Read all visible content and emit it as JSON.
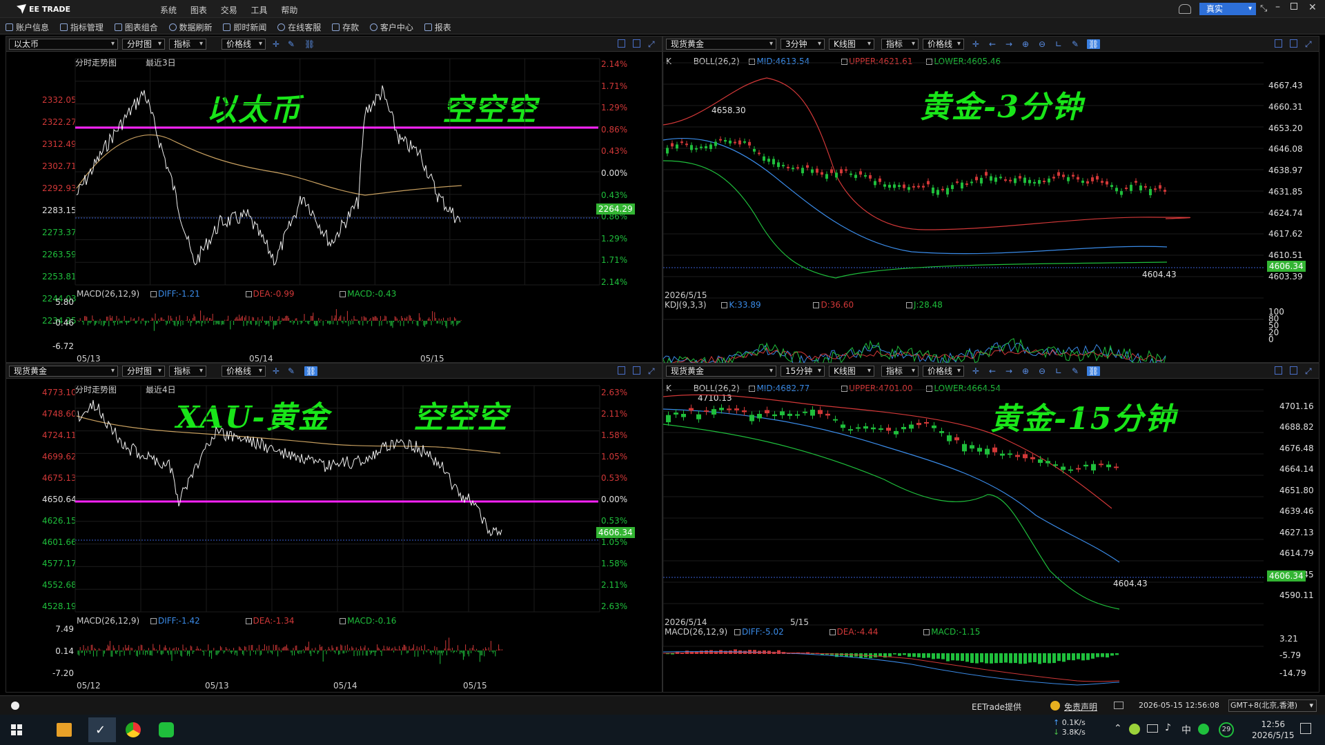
{
  "app": {
    "logo": "EE TRADE",
    "menus": [
      "系统",
      "图表",
      "交易",
      "工具",
      "帮助"
    ],
    "mode": "真实"
  },
  "toolbar": [
    "账户信息",
    "指标管理",
    "图表组合",
    "数据刷新",
    "即时新闻",
    "在线客服",
    "存款",
    "客户中心",
    "报表"
  ],
  "panels": {
    "p1": {
      "symbol": "以太币",
      "period": "分时图",
      "indicator": "指标",
      "priceline": "价格线",
      "subtitle": "分时走势图",
      "range": "最近3日",
      "title_left": "以太币",
      "title_right": "空空空",
      "left_axis": [
        "2332.05",
        "2322.27",
        "2312.49",
        "2302.71",
        "2292.93",
        "2283.15",
        "2273.37",
        "2263.59",
        "2253.81",
        "2244.03",
        "2234.25"
      ],
      "right_axis": [
        "2.14%",
        "1.71%",
        "1.29%",
        "0.86%",
        "0.43%",
        "0.00%",
        "0.43%",
        "0.86%",
        "1.29%",
        "1.71%",
        "2.14%"
      ],
      "current_price": "2264.29",
      "macd_label": "MACD(26,12,9)",
      "diff": "DIFF:-1.21",
      "dea": "DEA:-0.99",
      "macd": "MACD:-0.43",
      "macd_axis": [
        "5.80",
        "-0.46",
        "-6.72"
      ],
      "dates": [
        "05/13",
        "05/14",
        "05/15"
      ]
    },
    "p2": {
      "symbol": "现货黄金",
      "period": "3分钟",
      "type": "K线图",
      "indicator": "指标",
      "priceline": "价格线",
      "k": "K",
      "boll": "BOLL(26,2)",
      "mid": "MID:4613.54",
      "upper": "UPPER:4621.61",
      "lower": "LOWER:4605.46",
      "title": "黄金-3分钟",
      "right_axis": [
        "4667.43",
        "4660.31",
        "4653.20",
        "4646.08",
        "4638.97",
        "4631.85",
        "4624.74",
        "4617.62",
        "4610.51",
        "4603.39"
      ],
      "high_label": "4658.30",
      "low_label": "4604.43",
      "current_price": "4606.34",
      "date": "2026/5/15",
      "kdj_label": "KDJ(9,3,3)",
      "kdj_k": "K:33.89",
      "kdj_d": "D:36.60",
      "kdj_j": "J:28.48",
      "kdj_axis": [
        "100",
        "80",
        "50",
        "20",
        "0"
      ]
    },
    "p3": {
      "symbol": "现货黄金",
      "period": "分时图",
      "indicator": "指标",
      "priceline": "价格线",
      "subtitle": "分时走势图",
      "range": "最近4日",
      "title_left": "XAU-黄金",
      "title_right": "空空空",
      "left_axis": [
        "4773.10",
        "4748.60",
        "4724.11",
        "4699.62",
        "4675.13",
        "4650.64",
        "4626.15",
        "4601.66",
        "4577.17",
        "4552.68",
        "4528.19"
      ],
      "right_axis": [
        "2.63%",
        "2.11%",
        "1.58%",
        "1.05%",
        "0.53%",
        "0.00%",
        "0.53%",
        "1.05%",
        "1.58%",
        "2.11%",
        "2.63%"
      ],
      "current_price": "4606.34",
      "macd_label": "MACD(26,12,9)",
      "diff": "DIFF:-1.42",
      "dea": "DEA:-1.34",
      "macd": "MACD:-0.16",
      "macd_axis": [
        "7.49",
        "0.14",
        "-7.20"
      ],
      "dates": [
        "05/12",
        "05/13",
        "05/14",
        "05/15"
      ]
    },
    "p4": {
      "symbol": "现货黄金",
      "period": "15分钟",
      "type": "K线图",
      "indicator": "指标",
      "priceline": "价格线",
      "k": "K",
      "boll": "BOLL(26,2)",
      "mid": "MID:4682.77",
      "upper": "UPPER:4701.00",
      "lower": "LOWER:4664.54",
      "title": "黄金-15分钟",
      "right_axis": [
        "4701.16",
        "4688.82",
        "4676.48",
        "4664.14",
        "4651.80",
        "4639.46",
        "4627.13",
        "4614.79",
        "4602.45",
        "4590.11"
      ],
      "high_label": "4710.13",
      "low_label": "4604.43",
      "current_price": "4606.34",
      "date1": "2026/5/14",
      "date2": "5/15",
      "macd_label": "MACD(26,12,9)",
      "diff": "DIFF:-5.02",
      "dea": "DEA:-4.44",
      "macd": "MACD:-1.15",
      "macd_axis": [
        "3.21",
        "-5.79",
        "-14.79"
      ]
    }
  },
  "status": {
    "provider": "EETrade提供",
    "disclaimer": "免责声明",
    "datetime": "2026-05-15 12:56:08",
    "tz": "GMT+8(北京,香港)"
  },
  "taskbar": {
    "up": "0.1K/s",
    "down": "3.8K/s",
    "ime": "中",
    "badge": "29",
    "time": "12:56",
    "date": "2026/5/15"
  },
  "colors": {
    "accent": "#3a7fe0",
    "magenta": "#ff22ff",
    "green": "#19e619",
    "red": "#d23838"
  }
}
